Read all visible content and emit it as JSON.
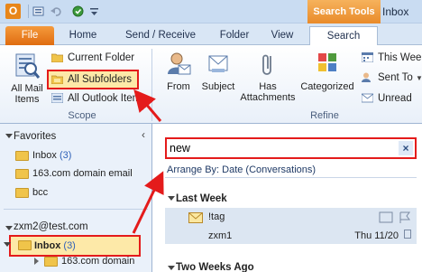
{
  "titlebar": {
    "app_icon_letter": "O",
    "contextual_tab_group": "Search Tools",
    "window_title": "Inbox"
  },
  "tabs": [
    "File",
    "Home",
    "Send / Receive",
    "Folder",
    "View",
    "Search"
  ],
  "ribbon": {
    "scope": {
      "label": "Scope",
      "all_mail_items_line1": "All Mail",
      "all_mail_items_line2": "Items",
      "current_folder": "Current Folder",
      "all_subfolders": "All Subfolders",
      "all_outlook_items": "All Outlook Items"
    },
    "refine": {
      "label": "Refine",
      "from": "From",
      "subject": "Subject",
      "has_attachments_line1": "Has",
      "has_attachments_line2": "Attachments",
      "categorized": "Categorized",
      "this_week": "This Wee",
      "sent_to": "Sent To",
      "unread": "Unread"
    }
  },
  "nav": {
    "favorites_label": "Favorites",
    "favorites": [
      {
        "name": "Inbox",
        "count": "(3)"
      },
      {
        "name": "163.com domain email",
        "count": ""
      },
      {
        "name": "bcc",
        "count": ""
      }
    ],
    "account": "zxm2@test.com",
    "folders": [
      {
        "name": "Inbox",
        "count": "(3)"
      },
      {
        "name": "163.com domain",
        "count": ""
      }
    ]
  },
  "mail_list": {
    "search_value": "new",
    "clear_glyph": "×",
    "arrange_by": "Arrange By: Date (Conversations)",
    "groups": [
      {
        "heading": "Last Week",
        "items": [
          {
            "subject": "!tag",
            "sender": "zxm1",
            "date": "Thu 11/20"
          }
        ]
      },
      {
        "heading": "Two Weeks Ago",
        "items": []
      }
    ]
  },
  "colors": {
    "highlight": "#e41b1b",
    "file_tab": "#e06c10",
    "search_tools": "#e98b2a",
    "selected_row": "#dce6f2"
  }
}
